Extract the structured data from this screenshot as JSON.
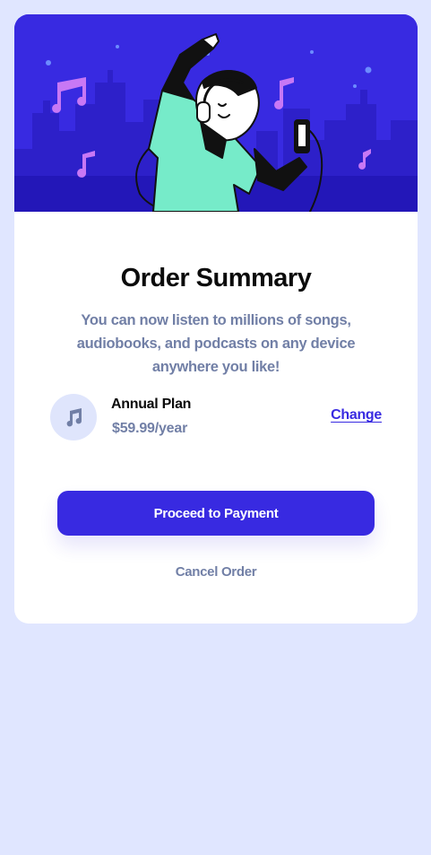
{
  "hero": {
    "illustration": "person-dancing-with-headphones-city-night"
  },
  "card": {
    "title": "Order Summary",
    "description": "You can now listen to millions of songs, audiobooks, and podcasts on any device anywhere you like!"
  },
  "plan": {
    "icon": "music-note-icon",
    "name": "Annual Plan",
    "price": "$59.99/year",
    "change_label": "Change"
  },
  "actions": {
    "proceed_label": "Proceed to Payment",
    "cancel_label": "Cancel Order"
  },
  "colors": {
    "page_background": "#e0e6ff",
    "primary": "#382ae1",
    "text_dark": "#0b0b0b",
    "text_muted": "#717fa6",
    "icon_background": "#dfe5fc",
    "hero_shirt": "#76ebc9"
  }
}
